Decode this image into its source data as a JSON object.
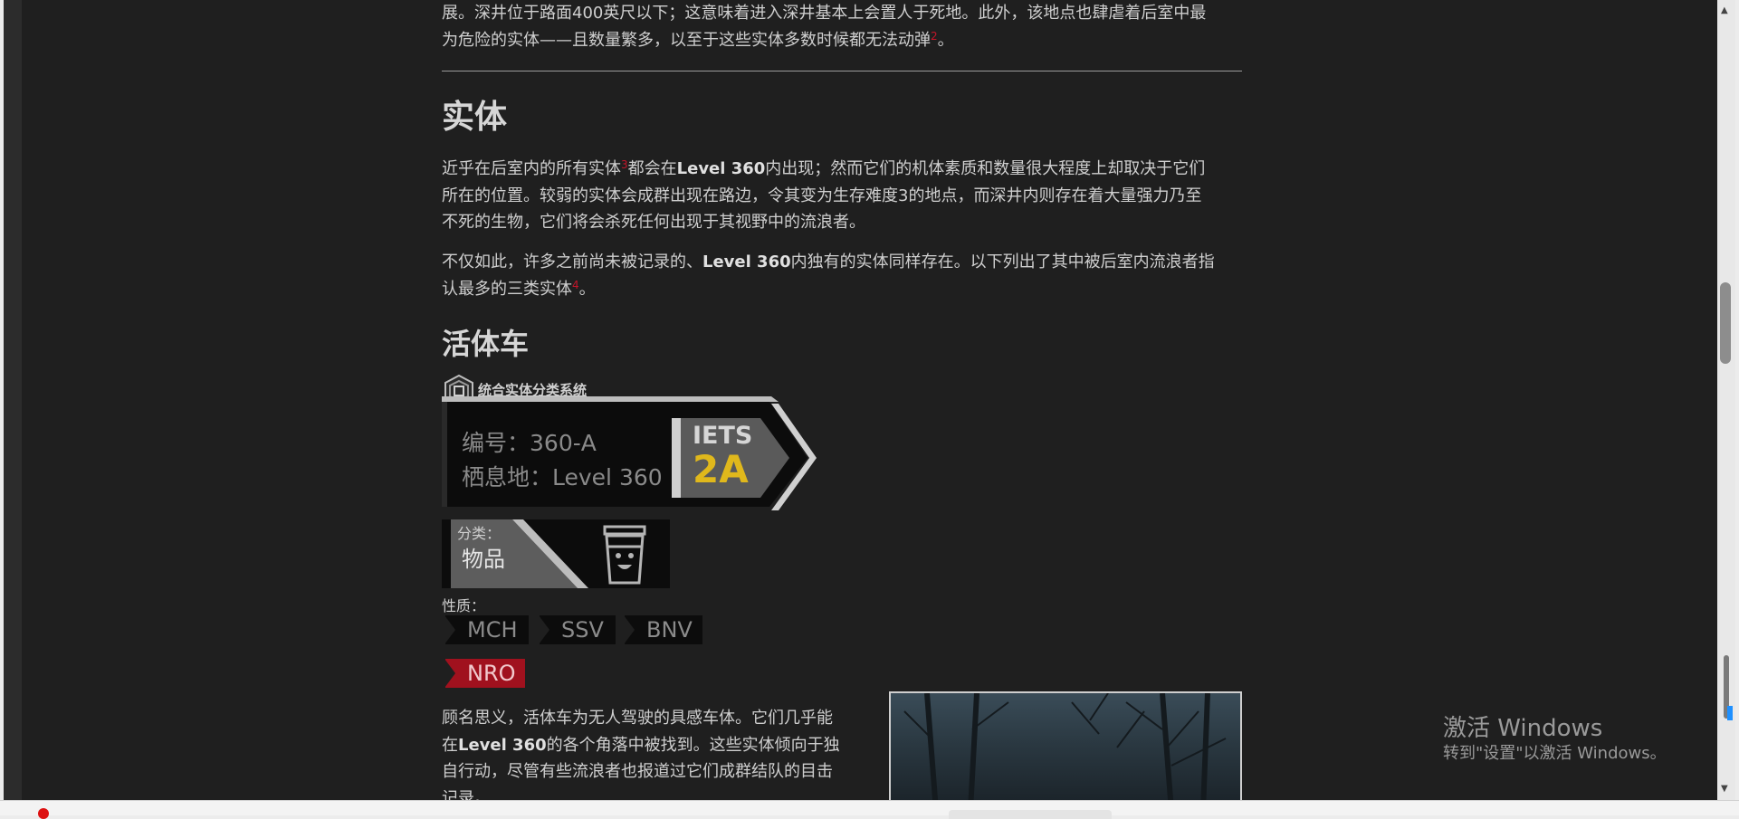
{
  "article": {
    "intro_line1": "展。深井位于路面400英尺以下；这意味着进入深井基本上会置人于死地。此外，该地点也肆虐着后室中最",
    "intro_line2": "为危险的实体——且数量繁多，以至于这些实体多数时候都无法动弹",
    "intro_fn": "2",
    "intro_end": "。",
    "section_heading": "实体",
    "p1_a": "近乎在后室内的所有实体",
    "p1_fn": "3",
    "p1_b": "都会在",
    "p1_bold": "Level 360",
    "p1_c": "内出现；然而它们的机体素质和数量很大程度上却取决于它们",
    "p1_line2": "所在的位置。较弱的实体会成群出现在路边，令其变为生存难度3的地点，而深井内则存在着大量强力乃至",
    "p1_line3": "不死的生物，它们将会杀死任何出现于其视野中的流浪者。",
    "p2_a": "不仅如此，许多之前尚未被记录的、",
    "p2_bold": "Level 360",
    "p2_b": "内独有的实体同样存在。以下列出了其中被后室内流浪者指",
    "p2_line2": "认最多的三类实体",
    "p2_fn": "4",
    "p2_end": "。",
    "subheading": "活体车",
    "p3_line1": "顾名思义，活体车为无人驾驶的具感车体。它们几乎能",
    "p3_line2a": "在",
    "p3_bold": "Level 360",
    "p3_line2b": "的各个角落中被找到。这些实体倾向于独",
    "p3_line3": "自行动，尽管有些流浪者也报道过它们成群结队的目击",
    "p3_line4": "记录。"
  },
  "ecs": {
    "system_title": "统合实体分类系统",
    "id_label": "编号：",
    "id_value": "360-A",
    "habitat_label": "栖息地：",
    "habitat_value": "Level 360",
    "iets_label": "IETS",
    "iets_value": "2A",
    "class_label": "分类：",
    "class_value": "物品",
    "class_icon": "cup-creature-icon",
    "nature_label": "性质：",
    "tags": [
      "MCH",
      "SSV",
      "BNV"
    ],
    "tag_highlight": "NRO",
    "colors": {
      "iets_yellow": "#e0b81c",
      "nro_red": "#a0111e"
    }
  },
  "watermark": {
    "line1": "激活 Windows",
    "line2": "转到\"设置\"以激活 Windows。"
  }
}
